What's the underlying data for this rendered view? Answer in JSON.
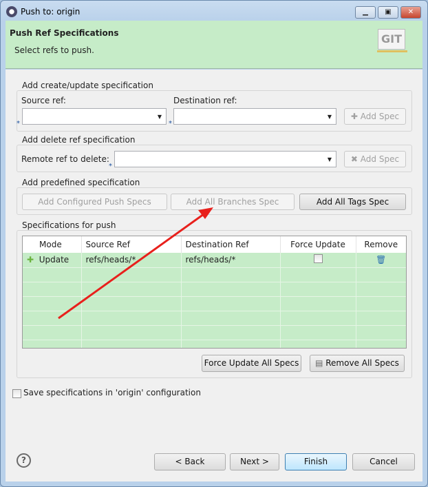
{
  "window": {
    "title": "Push to: origin"
  },
  "header": {
    "title": "Push Ref Specifications",
    "subtitle": "Select refs to push.",
    "logo_text": "GIT"
  },
  "create_group": {
    "label": "Add create/update specification",
    "source_label": "Source ref:",
    "source_value": "",
    "dest_label": "Destination ref:",
    "dest_value": "",
    "add_label": "Add Spec"
  },
  "delete_group": {
    "label": "Add delete ref specification",
    "remote_label": "Remote ref to delete:",
    "remote_value": "",
    "add_label": "Add Spec"
  },
  "predefined_group": {
    "label": "Add predefined specification",
    "buttons": [
      "Add Configured Push Specs",
      "Add All Branches Spec",
      "Add All Tags Spec"
    ]
  },
  "specs_group": {
    "label": "Specifications for push",
    "columns": [
      "Mode",
      "Source Ref",
      "Destination Ref",
      "Force Update",
      "Remove"
    ],
    "rows": [
      {
        "mode": "Update",
        "source": "refs/heads/*",
        "dest": "refs/heads/*",
        "force": false
      }
    ],
    "force_all_label": "Force Update All Specs",
    "remove_all_label": "Remove All Specs"
  },
  "save_checkbox": {
    "label": "Save specifications in 'origin' configuration",
    "checked": false
  },
  "footer": {
    "back": "< Back",
    "next": "Next >",
    "finish": "Finish",
    "cancel": "Cancel"
  },
  "annotation": {
    "arrow_color": "#e8201c"
  }
}
